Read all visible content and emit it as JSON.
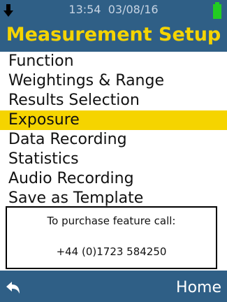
{
  "status": {
    "time": "13:54",
    "date": "03/08/16"
  },
  "header": {
    "title": "Measurement Setup"
  },
  "menu": {
    "items": [
      {
        "label": "Function"
      },
      {
        "label": "Weightings & Range"
      },
      {
        "label": "Results Selection"
      },
      {
        "label": "Exposure"
      },
      {
        "label": "Data Recording"
      },
      {
        "label": "Statistics"
      },
      {
        "label": "Audio Recording"
      },
      {
        "label": "Save as Template"
      }
    ],
    "selected": "Exposure"
  },
  "info": {
    "line1": "To purchase feature call:",
    "line2": "+44 (0)1723 584250"
  },
  "footer": {
    "home_label": "Home"
  },
  "colors": {
    "header_bg": "#2f5f86",
    "accent": "#f5d400",
    "battery": "#22cc22"
  },
  "icons": {
    "status_left": "down-arrow-icon",
    "status_right": "battery-icon",
    "footer_left": "back-arrow-icon"
  }
}
